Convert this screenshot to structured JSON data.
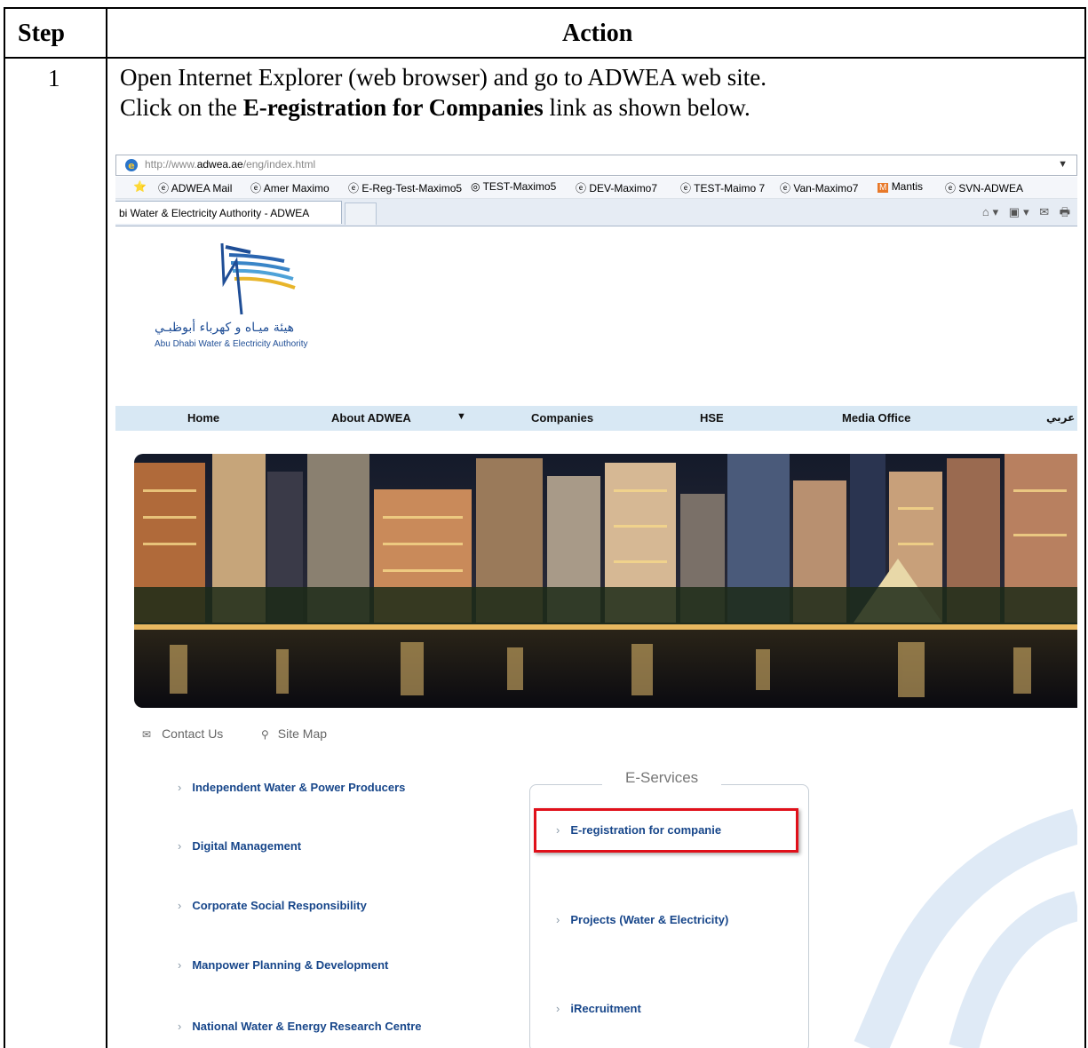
{
  "table": {
    "header_step": "Step",
    "header_action": "Action",
    "step_number": "1",
    "line1": "Open Internet Explorer (web browser) and go to ADWEA web site.",
    "line2_pre": "Click on the ",
    "line2_bold": "E-registration for Companies",
    "line2_post": " link as shown below."
  },
  "browser": {
    "url_prefix": "http://www.",
    "url_domain": "adwea.ae",
    "url_suffix": "/eng/index.html",
    "favorites": [
      "ADWEA Mail",
      "Amer Maximo",
      "E-Reg-Test-Maximo5",
      "TEST-Maximo5",
      "DEV-Maximo7",
      "TEST-Maimo 7",
      "Van-Maximo7",
      "Mantis",
      "SVN-ADWEA"
    ],
    "tab_title": "bi Water & Electricity Authority - ADWEA"
  },
  "site": {
    "logo_arabic": "هيئة ميـاه و كهرباء أبوظبـي",
    "logo_english": "Abu Dhabi Water & Electricity Authority",
    "nav": [
      "Home",
      "About ADWEA",
      "Companies",
      "HSE",
      "Media Office",
      "عربي"
    ],
    "contact_us": "Contact Us",
    "site_map": "Site Map",
    "left_links": [
      "Independent Water & Power Producers",
      "Digital Management",
      "Corporate Social Responsibility",
      "Manpower Planning & Development",
      "National Water & Energy Research Centre"
    ],
    "eservices_title": "E-Services",
    "eservices_links": [
      "E-registration for companie",
      "Projects (Water & Electricity)",
      "iRecruitment"
    ]
  }
}
